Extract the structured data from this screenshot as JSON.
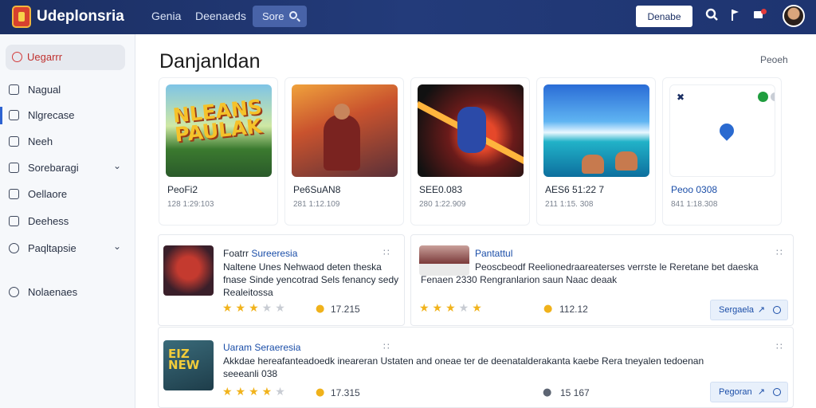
{
  "header": {
    "brand": "Udeplonsria",
    "nav": [
      "Genia",
      "Deenaeds"
    ],
    "search_label": "Sore",
    "action_button": "Denabe",
    "icons": [
      "search-icon",
      "flag-icon",
      "notification-icon"
    ],
    "notification_color": "#e23b3b"
  },
  "sidebar": {
    "items": [
      {
        "label": "Uegarrr",
        "icon": "home-icon",
        "active": true
      },
      {
        "label": "Nagual",
        "icon": "doc-icon"
      },
      {
        "label": "Nlgrecase",
        "icon": "doc-icon"
      },
      {
        "label": "Neeh",
        "icon": "mail-icon"
      },
      {
        "label": "Sorebaragi",
        "icon": "box-icon",
        "expandable": true
      },
      {
        "label": "Oellaore",
        "icon": "bag-icon"
      },
      {
        "label": "Deehess",
        "icon": "gallery-icon"
      },
      {
        "label": "Paqltapsie",
        "icon": "search-icon",
        "expandable": true
      },
      {
        "label": "Nolaenaes",
        "icon": "chat-icon"
      }
    ],
    "accent_color": "#c0312f"
  },
  "main": {
    "title": "Danjanldan",
    "title_action": "Peoeh",
    "cards": [
      {
        "name": "PeoFi2",
        "sub": "128 1:29:103",
        "thumb_text": "NLEANS PAULAK"
      },
      {
        "name": "Pe6SuAN8",
        "sub": "281 1:12.109"
      },
      {
        "name": "SEE0.083",
        "sub": "280 1:22.909"
      },
      {
        "name": "AES6 51:22 7",
        "sub": "211 1:15. 308"
      },
      {
        "name": "Peoo 0308",
        "sub": "841 1:18.308"
      }
    ],
    "list": [
      {
        "title_dark": "Foatrr",
        "title": "Sureeresia",
        "desc": [
          "Naltene Unes Nehwaod deten theska",
          "fnase Sinde yencotrad Sels fenancy sedy",
          "Realeitossa"
        ],
        "rating": 3,
        "count": "17.215"
      },
      {
        "title": "Pantattul",
        "desc": [
          "Peoscbeodf Reelionedraareaterses verrste le Reretane bet daeska",
          "Fenaen 2330  Rengranlarion saun Naac deaak"
        ],
        "rating": 3,
        "count": "112.12",
        "button": "Sergaela"
      },
      {
        "title": "Uaram Seraeresia",
        "desc": [
          "Akkdae hereafanteadoedk ineareran Ustaten and oneae ter de deenatalderakanta kaebe Rera tneyalen tedoenan",
          "seeeanli 038"
        ],
        "rating": 4,
        "count": "17.315",
        "count_right": "15  167",
        "button": "Pegoran"
      }
    ]
  }
}
